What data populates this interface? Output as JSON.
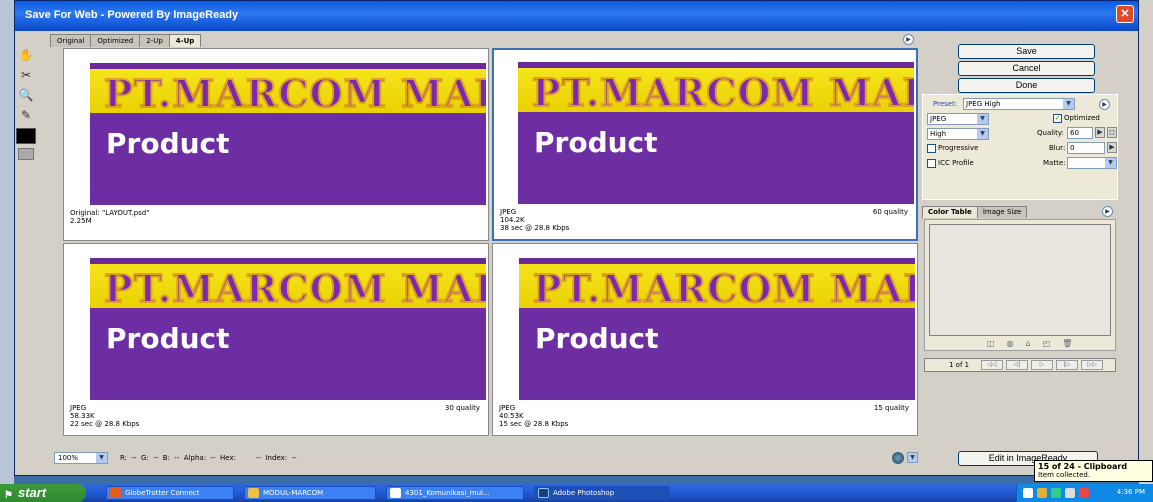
{
  "window": {
    "title": "Save For Web - Powered By ImageReady"
  },
  "tabs": [
    "Original",
    "Optimized",
    "2-Up",
    "4-Up"
  ],
  "active_tab": "4-Up",
  "image": {
    "brand_text": "PT.MARCOM MAI",
    "product_text": "Product"
  },
  "panes": [
    {
      "line1": "Original: \"LAYOUT.psd\"",
      "line2": "2.25M",
      "line3": "",
      "quality": ""
    },
    {
      "line1": "JPEG",
      "line2": "104.2K",
      "line3": "38 sec @ 28.8 Kbps",
      "quality": "60 quality"
    },
    {
      "line1": "JPEG",
      "line2": "58.33K",
      "line3": "22 sec @ 28.8 Kbps",
      "quality": "30 quality"
    },
    {
      "line1": "JPEG",
      "line2": "40.53K",
      "line3": "15 sec @ 28.8 Kbps",
      "quality": "15 quality"
    }
  ],
  "buttons": {
    "save": "Save",
    "cancel": "Cancel",
    "done": "Done",
    "edit": "Edit in ImageReady"
  },
  "settings": {
    "preset_label": "Preset:",
    "preset_value": "JPEG High",
    "format": "JPEG",
    "optimized_label": "Optimized",
    "optimized_checked": true,
    "compression": "High",
    "quality_label": "Quality:",
    "quality_value": "60",
    "progressive_label": "Progressive",
    "blur_label": "Blur:",
    "blur_value": "0",
    "icc_label": "ICC Profile",
    "matte_label": "Matte:"
  },
  "color_tabs": [
    "Color Table",
    "Image Size"
  ],
  "page_indicator": "1 of 1",
  "status": {
    "zoom": "100%",
    "readout": "R:  --  G:  --  B:  --  Alpha:  --  Hex:         --  Index:  --"
  },
  "balloon": {
    "title": "15 of 24 - Clipboard",
    "body": "Item collected."
  },
  "taskbar": {
    "start": "start",
    "tasks": [
      "GlobeTrotter Connect",
      "MODUL-MARCOM",
      "4301_Komunikasi_mul...",
      "Adobe Photoshop"
    ],
    "clock": "4:36 PM"
  },
  "colors": {
    "accent": "#3c6fb5",
    "banner_purple": "#6d2ea3",
    "banner_yellow": "#f5e41c",
    "titlebar": "#0a5be0"
  },
  "icons": [
    "hand-icon",
    "slice-select-icon",
    "zoom-icon",
    "eyedropper-icon",
    "eyedropper-color-swatch",
    "slice-visibility-toggle",
    "menu-arrow-icon",
    "browser-preview-icon"
  ]
}
